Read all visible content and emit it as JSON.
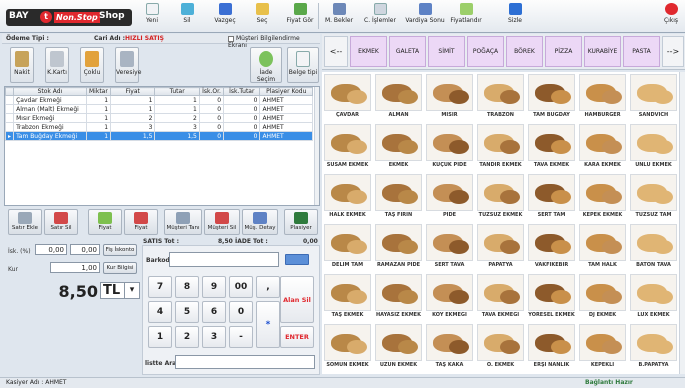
{
  "logo": {
    "part1": "BAY",
    "circle": "t",
    "part2": "Non.Stop",
    "part3": "Shop"
  },
  "toolbar": {
    "yeni": "Yeni",
    "sil": "Sil",
    "vazgec": "Vazgeç",
    "sec": "Seç",
    "fiyat_gor": "Fiyat Gör",
    "m_bekler": "M. Bekler",
    "c_islemler": "C. İşlemler",
    "vardiya_sonu": "Vardiya Sonu",
    "fiyatlandir": "Fiyatlandır",
    "sizle": "Sizle",
    "cikis": "Çıkış"
  },
  "sale": {
    "odeme_tipi_label": "Ödeme Tipi :",
    "cari_adi_label": "Cari Adı :",
    "cari_adi_value": "HIZLI SATIŞ",
    "musteri_check_label": "Müşteri Bilgilendirme Ekranı"
  },
  "payment_buttons": {
    "nakit": "Nakit",
    "kart": "K.Kartı",
    "coklu": "Çoklu",
    "veresiye": "Veresiye",
    "iade": "İade Seçim",
    "belge": "Belge tipi"
  },
  "grid": {
    "headers": [
      "Stok Adı",
      "Miktar",
      "Fiyat",
      "Tutar",
      "İsk.Or.",
      "İsk.Tutar",
      "Plasiyer Kodu"
    ],
    "rows": [
      {
        "ad": "Çavdar Ekmeği",
        "miktar": "1",
        "fiyat": "1",
        "tutar": "1",
        "isk_or": "0",
        "isk_tutar": "0",
        "plasiyer": "AHMET"
      },
      {
        "ad": "Alman (Malt) Ekmeği",
        "miktar": "1",
        "fiyat": "1",
        "tutar": "1",
        "isk_or": "0",
        "isk_tutar": "0",
        "plasiyer": "AHMET"
      },
      {
        "ad": "Mısır Ekmeği",
        "miktar": "1",
        "fiyat": "2",
        "tutar": "2",
        "isk_or": "0",
        "isk_tutar": "0",
        "plasiyer": "AHMET"
      },
      {
        "ad": "Trabzon Ekmeği",
        "miktar": "1",
        "fiyat": "3",
        "tutar": "3",
        "isk_or": "0",
        "isk_tutar": "0",
        "plasiyer": "AHMET"
      },
      {
        "ad": "Tam Buğday Ekmeği",
        "miktar": "1",
        "fiyat": "1,5",
        "tutar": "1,5",
        "isk_or": "0",
        "isk_tutar": "0",
        "plasiyer": "AHMET"
      }
    ]
  },
  "actions": {
    "satir_ekle": "Satır Ekle",
    "satir_sil": "Satır Sil",
    "fiyat1": "Fiyat",
    "fiyat2": "Fiyat",
    "musteri_tani": "Müşteri Tanı",
    "musteri_sil": "Müşteri Sil",
    "mus_detay": "Müş. Detay",
    "plasiyer": "Plasiyer"
  },
  "discount": {
    "isk_label": "İsk. (%)",
    "isk_pct": "0,00",
    "isk_amount": "0,00",
    "fis_iskonto": "Fiş İskonto",
    "kur_label": "Kur",
    "kur_value": "1,00",
    "kur_bilgisi": "Kur Bilgisi"
  },
  "total": {
    "value": "8,50",
    "currency": "TL"
  },
  "summary": {
    "satis_tot_label": "SATIS Tot :",
    "satis_tot": "8,50",
    "iade_tot_label": "İADE Tot :",
    "iade_tot": "0,00"
  },
  "keypad": {
    "barkod_label": "Barkod",
    "keys": [
      "7",
      "8",
      "9",
      "00",
      ",",
      "4",
      "5",
      "6",
      "0",
      "1",
      "2",
      "3",
      "-"
    ],
    "alan_sil": "Alan Sil",
    "star": "*",
    "enter": "ENTER",
    "liste_ara_label": "listte Ara"
  },
  "categories": [
    "EKMEK",
    "GALETA",
    "SİMİT",
    "POĞAÇA",
    "BÖREK",
    "PİZZA",
    "KURABİYE",
    "PASTA"
  ],
  "nav": {
    "prev": "<--",
    "next": "-->"
  },
  "products": [
    "ÇAVDAR",
    "ALMAN",
    "MISIR",
    "TRABZON",
    "TAM BUĞDAY",
    "HAMBURGER",
    "SANDVICH",
    "SUSAM EKMEK",
    "EKMEK",
    "KÜÇÜK PİDE",
    "TANDIR EKMEK",
    "TAVA EKMEK",
    "KARA EKMEK",
    "UNLU EKMEK",
    "HALK EKMEK",
    "TAŞ FIRIN",
    "PİDE",
    "TUZSUZ EKMEK",
    "SERT TAM",
    "KEPEK EKMEK",
    "TUZSUZ TAM",
    "DELİM TAM",
    "RAMAZAN PİDE",
    "SERT TAVA",
    "PAPATYA",
    "VAKFIKEBİR",
    "TAM HALK",
    "BATON TAVA",
    "TAŞ EKMEK",
    "HAYASIZ EKMEK",
    "KÖY EKMEĞİ",
    "TAVA EKMEĞİ",
    "YÖRESEL EKMEK",
    "DJ EKMEK",
    "LÜX EKMEK",
    "SOMUN EKMEK",
    "UZUN EKMEK",
    "TAŞ KAKA",
    "Ö. EKMEK",
    "ERŞİ NANLIK",
    "KEPEKLİ",
    "B.PAPATYA"
  ],
  "status": {
    "kasiyer": "Kasiyer Adı : AHMET",
    "baglanti": "Bağlantı Hazır"
  }
}
